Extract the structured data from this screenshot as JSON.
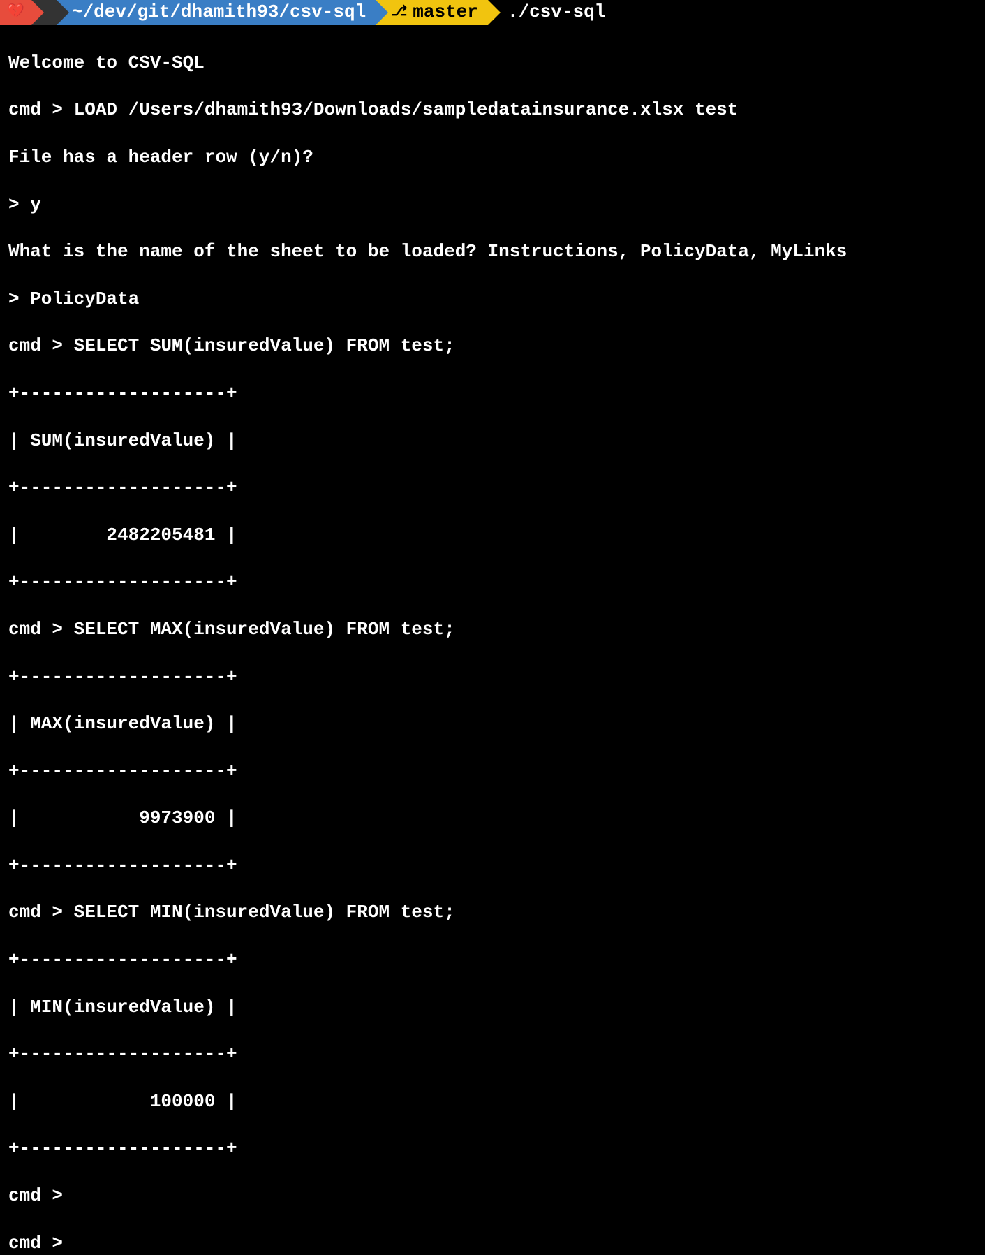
{
  "prompt": {
    "heart_icon": "💔",
    "apple_icon": "",
    "path": "~/dev/git/dhamith93/csv-sql",
    "branch_icon": "⎇",
    "branch": "master",
    "command": "./csv-sql"
  },
  "session": {
    "welcome": "Welcome to CSV-SQL",
    "load_cmd": "cmd > LOAD /Users/dhamith93/Downloads/sampledatainsurance.xlsx test",
    "header_prompt": "File has a header row (y/n)?",
    "header_answer": "> y",
    "sheet_prompt": "What is the name of the sheet to be loaded? Instructions, PolicyData, MyLinks",
    "sheet_answer": "> PolicyData",
    "queries": [
      {
        "cmd": "cmd > SELECT SUM(insuredValue) FROM test;",
        "border": "+-------------------+",
        "header": "| SUM(insuredValue) |",
        "value": "|        2482205481 |"
      },
      {
        "cmd": "cmd > SELECT MAX(insuredValue) FROM test;",
        "border": "+-------------------+",
        "header": "| MAX(insuredValue) |",
        "value": "|           9973900 |"
      },
      {
        "cmd": "cmd > SELECT MIN(insuredValue) FROM test;",
        "border": "+-------------------+",
        "header": "| MIN(insuredValue) |",
        "value": "|            100000 |"
      }
    ],
    "empty_prompt1": "cmd >",
    "empty_prompt2": "cmd > "
  }
}
